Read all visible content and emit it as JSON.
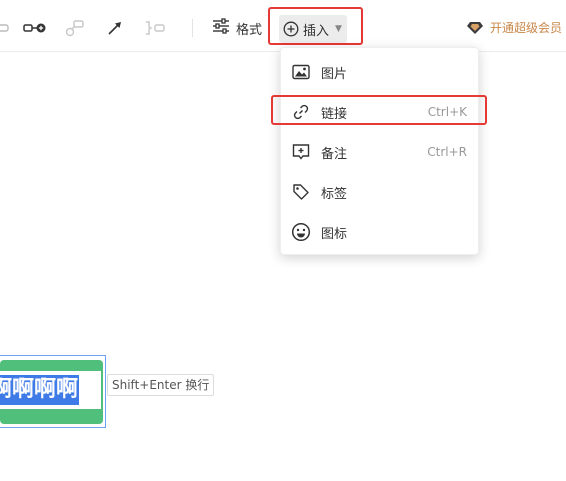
{
  "toolbar": {
    "format_label": "格式",
    "insert_label": "插入",
    "vip_label": "开通超级会员",
    "icons": [
      "left-partial-icon",
      "relation-icon",
      "summary-icon",
      "arrow-line-icon",
      "boundary-icon",
      "format-icon",
      "insert-plus-icon",
      "diamond-icon"
    ]
  },
  "insert_menu": {
    "items": [
      {
        "label": "图片",
        "icon": "image-icon",
        "shortcut": ""
      },
      {
        "label": "链接",
        "icon": "link-icon",
        "shortcut": "Ctrl+K"
      },
      {
        "label": "备注",
        "icon": "note-icon",
        "shortcut": "Ctrl+R"
      },
      {
        "label": "标签",
        "icon": "tag-icon",
        "shortcut": ""
      },
      {
        "label": "图标",
        "icon": "emoji-icon",
        "shortcut": ""
      }
    ],
    "highlighted_item": "链接"
  },
  "canvas": {
    "node_text": "啊啊啊啊",
    "input_hint": "Shift+Enter 换行"
  },
  "colors": {
    "highlight_red": "#e53935",
    "node_green": "#4fbf7b",
    "selection_blue": "#3f7be6",
    "vip_gold": "#c9884a"
  }
}
